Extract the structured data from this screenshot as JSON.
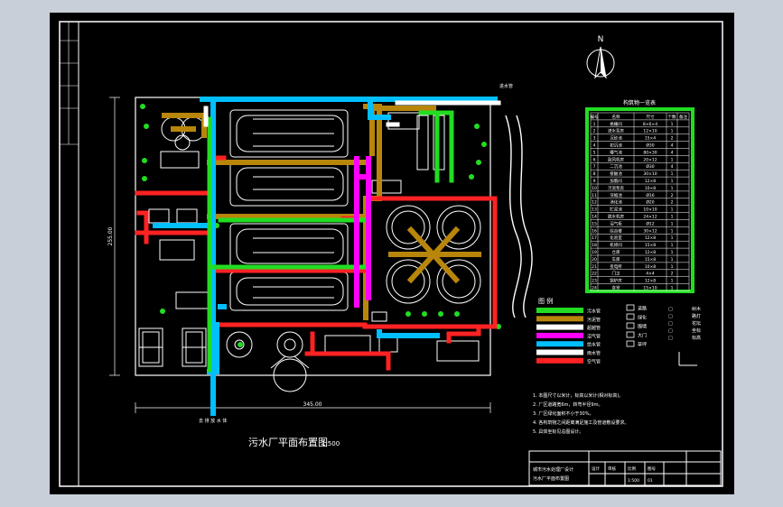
{
  "drawing": {
    "title": "污水厂平面布置图",
    "scale": "1:500",
    "north_label": "N",
    "outfall_label": "去 排 放 水 体",
    "inlet_label": "进水管",
    "dim_bottom": "345.00",
    "dim_left": "255.00"
  },
  "structures_table": {
    "title": "构筑物一览表",
    "header": [
      "编号",
      "名称",
      "尺寸",
      "个数",
      "备注"
    ],
    "rows": [
      [
        "1",
        "格栅间",
        "8×6×4",
        "1",
        ""
      ],
      [
        "2",
        "进水泵房",
        "12×10",
        "1",
        ""
      ],
      [
        "3",
        "沉砂池",
        "15×4",
        "2",
        ""
      ],
      [
        "4",
        "初沉池",
        "Ø30",
        "4",
        ""
      ],
      [
        "5",
        "曝气池",
        "80×30",
        "4",
        ""
      ],
      [
        "6",
        "鼓风机房",
        "20×12",
        "1",
        ""
      ],
      [
        "7",
        "二沉池",
        "Ø30",
        "4",
        ""
      ],
      [
        "8",
        "接触池",
        "30×10",
        "1",
        ""
      ],
      [
        "9",
        "加氯间",
        "12×8",
        "1",
        ""
      ],
      [
        "10",
        "污泥泵房",
        "10×8",
        "1",
        ""
      ],
      [
        "11",
        "浓缩池",
        "Ø16",
        "2",
        ""
      ],
      [
        "12",
        "消化池",
        "Ø20",
        "2",
        ""
      ],
      [
        "13",
        "贮泥池",
        "10×10",
        "1",
        ""
      ],
      [
        "14",
        "脱水机房",
        "24×12",
        "1",
        ""
      ],
      [
        "15",
        "沼气柜",
        "Ø12",
        "1",
        ""
      ],
      [
        "16",
        "综合楼",
        "30×12",
        "1",
        ""
      ],
      [
        "17",
        "化验室",
        "12×8",
        "1",
        ""
      ],
      [
        "18",
        "机修间",
        "15×8",
        "1",
        ""
      ],
      [
        "19",
        "仓库",
        "12×8",
        "1",
        ""
      ],
      [
        "20",
        "车库",
        "15×8",
        "1",
        ""
      ],
      [
        "21",
        "变电所",
        "10×8",
        "1",
        ""
      ],
      [
        "22",
        "门卫",
        "4×4",
        "2",
        ""
      ],
      [
        "23",
        "锅炉房",
        "12×8",
        "1",
        ""
      ],
      [
        "24",
        "食堂",
        "15×10",
        "1",
        ""
      ]
    ]
  },
  "legend": {
    "title": "图 例",
    "items": [
      {
        "label": "污水管",
        "color": "#22dd22"
      },
      {
        "label": "污泥管",
        "color": "#b8860b"
      },
      {
        "label": "超越管",
        "color": "#ffffff"
      },
      {
        "label": "沼气管",
        "color": "#ff00ff"
      },
      {
        "label": "给水管",
        "color": "#00bfff"
      },
      {
        "label": "雨水管",
        "color": "#ffffff"
      },
      {
        "label": "空气管",
        "color": "#ff2222"
      }
    ],
    "symbols": [
      {
        "label": "道路"
      },
      {
        "label": "绿化"
      },
      {
        "label": "围墙"
      },
      {
        "label": "大门"
      },
      {
        "label": "草坪"
      }
    ],
    "extra": [
      "树木",
      "路灯",
      "花坛",
      "坐标",
      "标高"
    ]
  },
  "notes": [
    "1. 本图尺寸以米计，标高以米计(相对标高)。",
    "2. 厂区道路宽6m，转弯半径9m。",
    "3. 厂区绿化面积不小于30%。",
    "4. 各构筑物之间距离满足施工及管道敷设要求。",
    "5. 具体坐标见总图设计。"
  ],
  "title_block": {
    "project": "城市污水处理厂设计",
    "drawing": "污水厂平面布置图",
    "col_labels": [
      "设计",
      "审核",
      "比例",
      "图号"
    ],
    "col_values": [
      "",
      "",
      "1:500",
      "01"
    ]
  },
  "colors": {
    "frame_bg": "#000000",
    "outer_bg": "#c9cfd9",
    "line": "#ffffff",
    "green": "#22dd22",
    "red": "#ff2222",
    "blue": "#00bfff",
    "brown": "#b8860b",
    "magenta": "#ff00ff"
  }
}
